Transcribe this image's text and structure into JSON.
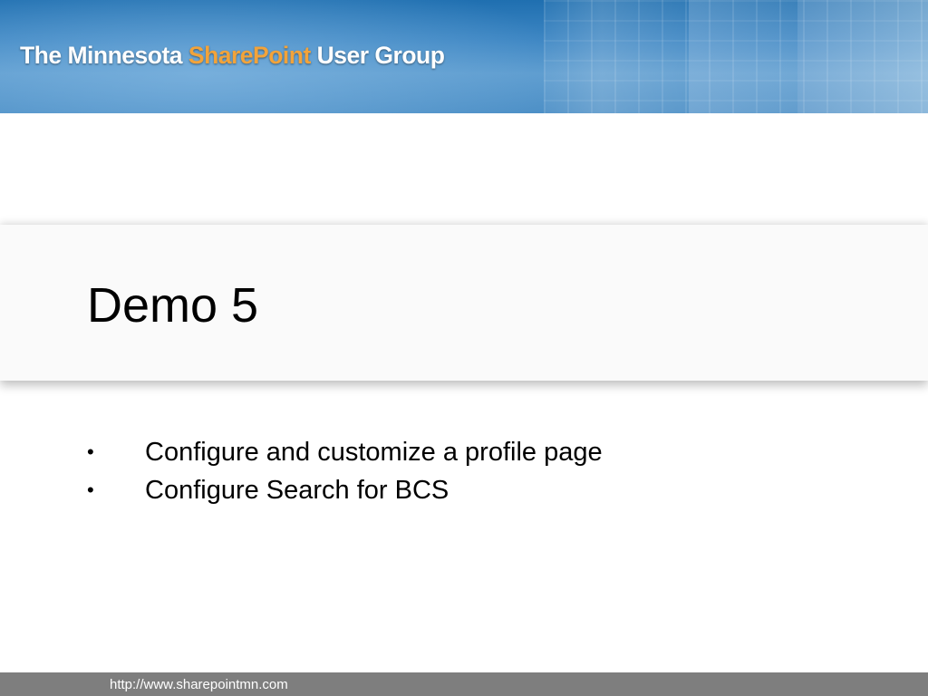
{
  "header": {
    "brand_prefix": "The Minnesota ",
    "brand_accent": "SharePoint",
    "brand_suffix": " User Group",
    "accent_color": "#f2a33a"
  },
  "slide": {
    "title": "Demo 5",
    "bullets": [
      "Configure and customize a profile page",
      "Configure Search for BCS"
    ],
    "bullet_glyph": "•"
  },
  "footer": {
    "url": "http://www.sharepointmn.com"
  }
}
